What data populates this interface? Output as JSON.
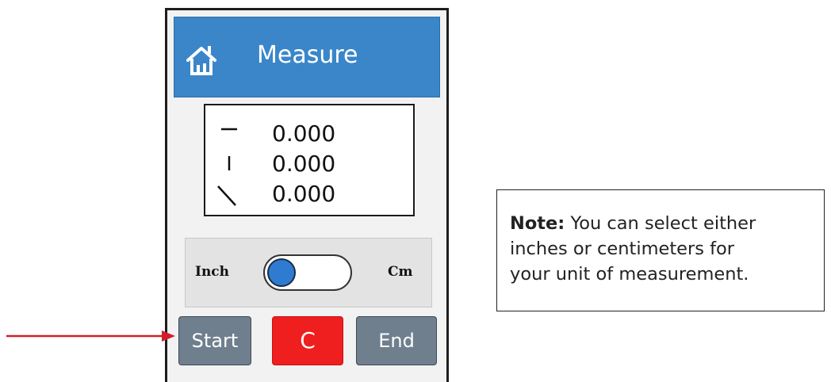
{
  "header": {
    "title": "Measure",
    "icon": "home-icon"
  },
  "readout": {
    "rows": [
      {
        "icon": "horizontal-line-icon",
        "value": "0.000"
      },
      {
        "icon": "vertical-line-icon",
        "value": "0.000"
      },
      {
        "icon": "diagonal-line-icon",
        "value": "0.000"
      }
    ]
  },
  "units": {
    "left_label": "Inch",
    "right_label": "Cm",
    "selected": "Inch"
  },
  "buttons": {
    "start": "Start",
    "clear": "C",
    "end": "End"
  },
  "note": {
    "lead": "Note:",
    "line1": " You can select either",
    "line2": "inches or centimeters for",
    "line3": "your unit of measurement."
  },
  "colors": {
    "header": "#3a86c9",
    "clear_button": "#ef1f1f",
    "gray_button": "#6f7f8e",
    "arrow": "#d0202e",
    "toggle_knob": "#2f7bd1"
  }
}
